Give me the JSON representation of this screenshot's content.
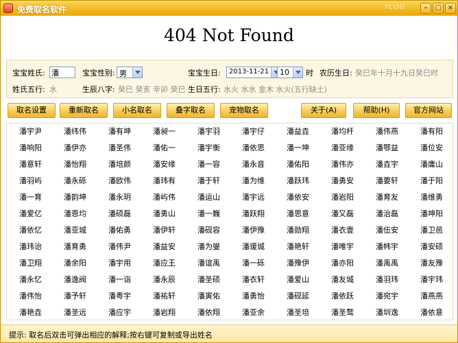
{
  "window": {
    "title": "免费取名软件",
    "brand_mark": "YCOU",
    "minimize": "–",
    "maximize": "□",
    "close": "×"
  },
  "page_error": "404 Not Found",
  "form": {
    "surname_label": "宝宝姓氏:",
    "surname_value": "潘",
    "gender_label": "宝宝性别:",
    "gender_value": "男",
    "birthday_label": "宝宝生日:",
    "birth_date": "2013-11-21",
    "birth_hour": "10",
    "hour_unit": "时",
    "lunar_label": "农历生日:",
    "lunar_value": "癸巳年十月十九日癸巳时",
    "surname_elements_label": "姓氏五行:",
    "surname_elements_value": "水",
    "bazi_label": "生辰八字:",
    "bazi_value": "癸巳 癸亥 辛卯 癸巳",
    "day_elements_label": "生日五行:",
    "day_elements_value": "水火 水水 金木 水火(五行缺土)"
  },
  "toolbar": [
    "取名设置",
    "重新取名",
    "小名取名",
    "叠字取名",
    "宠物取名",
    "关于(A)",
    "帮助(H)",
    "官方网站"
  ],
  "names": [
    [
      "潘宇尹",
      "潘纬伟",
      "潘有坤",
      "潘昶一",
      "潘宇羽",
      "潘宇仔",
      "潘益垚",
      "潘均杆",
      "潘伟燕",
      "潘有阳"
    ],
    [
      "潘响阳",
      "潘伊亦",
      "潘圣伟",
      "潘佑一",
      "潘宇衡",
      "潘依思",
      "潘一坤",
      "潘亚缘",
      "潘鄂益",
      "潘位安"
    ],
    [
      "潘意轩",
      "潘怡翔",
      "潘培颜",
      "潘安缘",
      "潘一容",
      "潘永音",
      "潘佑阳",
      "潘伟亦",
      "潘垚宇",
      "潘庸山"
    ],
    [
      "潘羽屿",
      "潘永砾",
      "潘欧伟",
      "潘玮有",
      "潘于轩",
      "潘为维",
      "潘跃玮",
      "潘勇安",
      "潘要轩",
      "潘于阳"
    ],
    [
      "潘一育",
      "潘韵坤",
      "潘永玥",
      "潘屿伟",
      "潘运山",
      "潘宇远",
      "潘依安",
      "潘岩阳",
      "潘育友",
      "潘维勇"
    ],
    [
      "潘爱亿",
      "潘恩均",
      "潘硕磊",
      "潘勇山",
      "潘一巍",
      "潘跃翔",
      "潘思意",
      "潘又磊",
      "潘治磊",
      "潘坤阳"
    ],
    [
      "潘依忆",
      "潘亚城",
      "潘佑勇",
      "潘伊轩",
      "潘砚容",
      "潘伊豫",
      "潘勋翔",
      "潘衣壹",
      "潘伍安",
      "潘卫邑"
    ],
    [
      "潘玮诒",
      "潘育勇",
      "潘伟尹",
      "潘益安",
      "潘为燮",
      "潘瑗城",
      "潘艳轩",
      "潘唯宇",
      "潘帏宇",
      "潘安硕"
    ],
    [
      "潘卫翔",
      "潘余阳",
      "潘宇用",
      "潘应王",
      "潘谊禹",
      "潘一砾",
      "潘豫伊",
      "潘亦阳",
      "潘禹禹",
      "潘友豫"
    ],
    [
      "潘永忆",
      "潘逸阀",
      "潘一诣",
      "潘永辰",
      "潘圣硕",
      "潘衣轩",
      "潘爱山",
      "潘友城",
      "潘羽玮",
      "潘宇玮"
    ],
    [
      "潘伟怡",
      "潘予轩",
      "潘粤宇",
      "潘祐轩",
      "潘寅佑",
      "潘勇怡",
      "潘砚延",
      "潘依跃",
      "潘宛宇",
      "潘燕燕"
    ],
    [
      "潘艳垚",
      "潘圣远",
      "潘应宇",
      "潘岩翔",
      "潘依翔",
      "潘亚余",
      "潘圣培",
      "潘圣鹜",
      "潘圳逸",
      "潘依意"
    ]
  ],
  "status": "提示: 取名后双击可弹出相应的解释;按右键可复制或导出姓名"
}
